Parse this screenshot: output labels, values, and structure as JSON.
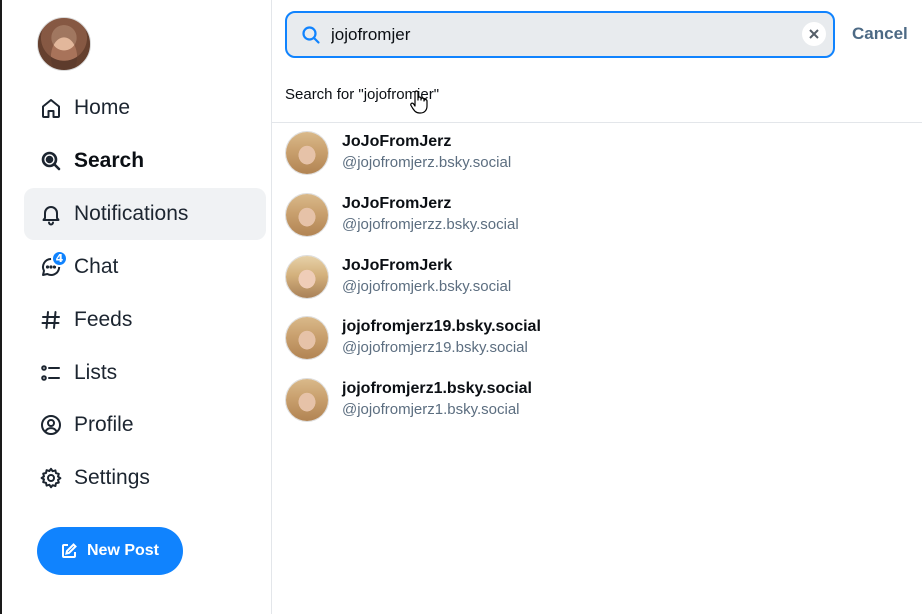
{
  "sidebar": {
    "items": [
      {
        "label": "Home",
        "icon": "home-icon"
      },
      {
        "label": "Search",
        "icon": "search-icon"
      },
      {
        "label": "Notifications",
        "icon": "bell-icon"
      },
      {
        "label": "Chat",
        "icon": "chat-icon",
        "badge": "4"
      },
      {
        "label": "Feeds",
        "icon": "hash-icon"
      },
      {
        "label": "Lists",
        "icon": "list-icon"
      },
      {
        "label": "Profile",
        "icon": "profile-icon"
      },
      {
        "label": "Settings",
        "icon": "gear-icon"
      }
    ],
    "new_post_label": "New Post"
  },
  "search": {
    "value": "jojofromjer",
    "cancel_label": "Cancel",
    "search_for_text": "Search for \"jojofromjer\""
  },
  "results": [
    {
      "name": "JoJoFromJerz",
      "handle": "@jojofromjerz.bsky.social"
    },
    {
      "name": "JoJoFromJerz",
      "handle": "@jojofromjerzz.bsky.social"
    },
    {
      "name": "JoJoFromJerk",
      "handle": "@jojofromjerk.bsky.social"
    },
    {
      "name": "jojofromjerz19.bsky.social",
      "handle": "@jojofromjerz19.bsky.social"
    },
    {
      "name": "jojofromjerz1.bsky.social",
      "handle": "@jojofromjerz1.bsky.social"
    }
  ],
  "colors": {
    "accent": "#1083fe",
    "active_bg": "#f0f2f4",
    "secondary_text": "#5c6e80",
    "cancel": "#4d6a85"
  }
}
